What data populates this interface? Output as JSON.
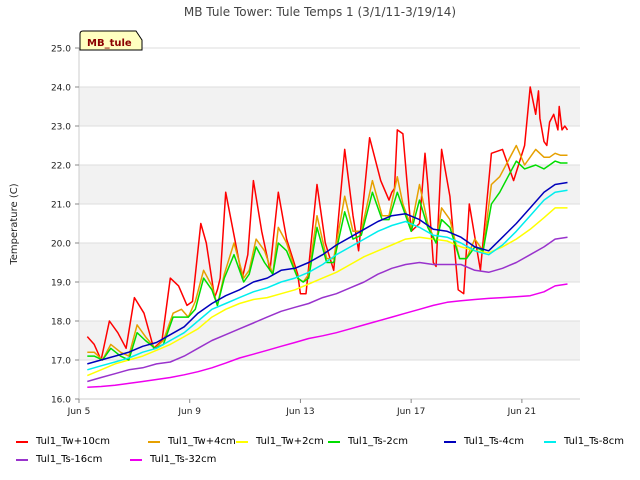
{
  "chart_data": {
    "type": "line",
    "title": "MB Tule Tower: Tule Temps 1 (3/1/11-3/19/14)",
    "site_label": "MB_tule",
    "xlabel": "",
    "ylabel": "Temperature (C)",
    "x_unit": "date (June)",
    "x_ticks": [
      {
        "value": 5,
        "label": "Jun 5"
      },
      {
        "value": 9,
        "label": "Jun 9"
      },
      {
        "value": 13,
        "label": "Jun 13"
      },
      {
        "value": 17,
        "label": "Jun 17"
      },
      {
        "value": 21,
        "label": "Jun 21"
      }
    ],
    "xlim": [
      5,
      23.1
    ],
    "ylim": [
      16.0,
      25.0
    ],
    "y_ticks": [
      "16.0",
      "17.0",
      "18.0",
      "19.0",
      "20.0",
      "21.0",
      "22.0",
      "23.0",
      "24.0",
      "25.0"
    ],
    "grid": true,
    "band_shading": true,
    "legend_position": "bottom",
    "series": [
      {
        "name": "Tul1_Tw+10cm",
        "color": "#ff0000",
        "x": [
          5.3,
          5.55,
          5.8,
          6.1,
          6.4,
          6.7,
          7.0,
          7.35,
          7.7,
          8.0,
          8.3,
          8.6,
          8.9,
          9.1,
          9.4,
          9.6,
          9.9,
          10.0,
          10.1,
          10.3,
          10.6,
          10.9,
          11.1,
          11.3,
          11.6,
          11.9,
          12.2,
          12.5,
          12.9,
          13.0,
          13.2,
          13.6,
          13.9,
          14.2,
          14.6,
          14.9,
          15.1,
          15.5,
          15.9,
          16.2,
          16.3,
          16.4,
          16.5,
          16.7,
          17.0,
          17.3,
          17.5,
          17.6,
          17.8,
          17.9,
          18.1,
          18.4,
          18.7,
          18.9,
          19.1,
          19.5,
          19.9,
          20.3,
          20.7,
          21.1,
          21.3,
          21.5,
          21.6,
          21.65,
          21.8,
          21.9,
          22.0,
          22.15,
          22.3,
          22.35,
          22.45,
          22.55,
          22.65
        ],
        "y": [
          17.6,
          17.4,
          17.0,
          18.0,
          17.7,
          17.3,
          18.6,
          18.2,
          17.3,
          17.5,
          19.1,
          18.9,
          18.4,
          18.5,
          20.5,
          20.0,
          18.6,
          18.8,
          19.1,
          21.3,
          20.2,
          19.1,
          19.7,
          21.6,
          20.3,
          19.3,
          21.3,
          20.1,
          19.2,
          18.7,
          18.7,
          21.5,
          20.0,
          19.3,
          22.4,
          20.7,
          19.8,
          22.7,
          21.6,
          21.1,
          21.3,
          21.4,
          22.9,
          22.8,
          20.3,
          20.5,
          22.3,
          21.5,
          19.5,
          19.4,
          22.4,
          21.2,
          18.8,
          18.7,
          21.0,
          19.3,
          22.3,
          22.4,
          21.6,
          22.5,
          24.0,
          23.3,
          23.9,
          23.2,
          22.6,
          22.5,
          23.1,
          23.3,
          22.9,
          23.5,
          22.9,
          23.0,
          22.9
        ]
      },
      {
        "name": "Tul1_Tw+4cm",
        "color": "#e6a000",
        "x": [
          5.3,
          5.55,
          5.85,
          6.15,
          6.5,
          6.8,
          7.1,
          7.4,
          7.75,
          8.05,
          8.4,
          8.7,
          8.95,
          9.2,
          9.5,
          9.8,
          10.0,
          10.25,
          10.6,
          10.95,
          11.15,
          11.4,
          11.7,
          12.0,
          12.2,
          12.5,
          12.9,
          13.1,
          13.3,
          13.6,
          13.95,
          14.2,
          14.6,
          14.9,
          15.2,
          15.6,
          15.95,
          16.2,
          16.5,
          16.7,
          17.0,
          17.3,
          17.6,
          17.9,
          18.1,
          18.4,
          18.75,
          19.0,
          19.3,
          19.6,
          19.9,
          20.2,
          20.5,
          20.8,
          21.1,
          21.5,
          21.8,
          22.0,
          22.2,
          22.4,
          22.65
        ],
        "y": [
          17.2,
          17.2,
          17.0,
          17.4,
          17.2,
          17.1,
          17.9,
          17.6,
          17.3,
          17.5,
          18.2,
          18.3,
          18.1,
          18.5,
          19.3,
          18.9,
          18.4,
          19.2,
          20.0,
          19.1,
          19.3,
          20.1,
          19.8,
          19.2,
          20.4,
          20.0,
          19.1,
          19.0,
          19.2,
          20.7,
          19.6,
          19.6,
          21.2,
          20.3,
          20.3,
          21.6,
          20.7,
          20.7,
          21.7,
          21.0,
          20.4,
          21.5,
          20.5,
          20.0,
          20.9,
          20.6,
          19.6,
          19.6,
          20.1,
          19.8,
          21.5,
          21.7,
          22.1,
          22.5,
          22.0,
          22.4,
          22.2,
          22.2,
          22.3,
          22.25,
          22.25
        ]
      },
      {
        "name": "Tul1_Tw+2cm",
        "color": "#ffff00",
        "x": [
          5.3,
          5.8,
          6.3,
          6.8,
          7.3,
          7.8,
          8.3,
          8.8,
          9.3,
          9.8,
          10.3,
          10.8,
          11.3,
          11.8,
          12.3,
          12.8,
          13.3,
          13.8,
          14.3,
          14.8,
          15.3,
          15.8,
          16.3,
          16.8,
          17.3,
          17.8,
          18.3,
          18.8,
          19.3,
          19.8,
          20.3,
          20.8,
          21.3,
          21.8,
          22.2,
          22.65
        ],
        "y": [
          16.6,
          16.75,
          16.9,
          17.0,
          17.1,
          17.25,
          17.4,
          17.6,
          17.8,
          18.1,
          18.3,
          18.45,
          18.55,
          18.6,
          18.7,
          18.8,
          18.95,
          19.1,
          19.25,
          19.45,
          19.65,
          19.8,
          19.95,
          20.1,
          20.15,
          20.1,
          20.05,
          19.9,
          19.8,
          19.75,
          19.9,
          20.1,
          20.35,
          20.65,
          20.9,
          20.9
        ]
      },
      {
        "name": "Tul1_Ts-2cm",
        "color": "#00dd00",
        "x": [
          5.3,
          5.55,
          5.85,
          6.15,
          6.5,
          6.8,
          7.1,
          7.4,
          7.75,
          8.05,
          8.4,
          8.7,
          8.95,
          9.2,
          9.5,
          9.8,
          10.0,
          10.25,
          10.6,
          10.95,
          11.15,
          11.4,
          11.7,
          12.0,
          12.2,
          12.5,
          12.9,
          13.1,
          13.3,
          13.6,
          13.95,
          14.2,
          14.6,
          14.9,
          15.2,
          15.6,
          15.95,
          16.2,
          16.5,
          16.7,
          17.0,
          17.3,
          17.6,
          17.9,
          18.1,
          18.4,
          18.75,
          19.0,
          19.3,
          19.6,
          19.9,
          20.2,
          20.5,
          20.8,
          21.1,
          21.5,
          21.8,
          22.0,
          22.2,
          22.4,
          22.65
        ],
        "y": [
          17.1,
          17.1,
          17.0,
          17.3,
          17.1,
          17.0,
          17.7,
          17.5,
          17.3,
          17.4,
          18.1,
          18.1,
          18.1,
          18.3,
          19.1,
          18.8,
          18.4,
          19.1,
          19.7,
          19.0,
          19.2,
          19.9,
          19.5,
          19.2,
          20.0,
          19.8,
          19.1,
          19.0,
          19.1,
          20.4,
          19.5,
          19.5,
          20.8,
          20.1,
          20.2,
          21.3,
          20.6,
          20.6,
          21.3,
          20.9,
          20.3,
          21.1,
          20.4,
          20.0,
          20.6,
          20.4,
          19.6,
          19.6,
          19.9,
          19.8,
          21.0,
          21.3,
          21.7,
          22.1,
          21.9,
          22.0,
          21.9,
          22.0,
          22.1,
          22.05,
          22.05
        ]
      },
      {
        "name": "Tul1_Ts-4cm",
        "color": "#0000bb",
        "x": [
          5.3,
          5.8,
          6.3,
          6.8,
          7.3,
          7.8,
          8.3,
          8.8,
          9.3,
          9.8,
          10.3,
          10.8,
          11.3,
          11.8,
          12.3,
          12.8,
          13.3,
          13.8,
          14.3,
          14.8,
          15.3,
          15.8,
          16.3,
          16.8,
          17.3,
          17.8,
          18.3,
          18.8,
          19.3,
          19.8,
          20.3,
          20.8,
          21.3,
          21.8,
          22.2,
          22.65
        ],
        "y": [
          16.9,
          17.0,
          17.1,
          17.2,
          17.35,
          17.45,
          17.65,
          17.85,
          18.2,
          18.45,
          18.65,
          18.8,
          19.0,
          19.1,
          19.3,
          19.35,
          19.5,
          19.7,
          19.95,
          20.15,
          20.35,
          20.55,
          20.7,
          20.75,
          20.6,
          20.35,
          20.3,
          20.15,
          19.9,
          19.8,
          20.15,
          20.5,
          20.9,
          21.3,
          21.5,
          21.55
        ]
      },
      {
        "name": "Tul1_Ts-8cm",
        "color": "#00eeee",
        "x": [
          5.3,
          5.8,
          6.3,
          6.8,
          7.3,
          7.8,
          8.3,
          8.8,
          9.3,
          9.8,
          10.3,
          10.8,
          11.3,
          11.8,
          12.3,
          12.8,
          13.3,
          13.8,
          14.3,
          14.8,
          15.3,
          15.8,
          16.3,
          16.8,
          17.3,
          17.8,
          18.3,
          18.8,
          19.3,
          19.8,
          20.3,
          20.8,
          21.3,
          21.8,
          22.2,
          22.65
        ],
        "y": [
          16.75,
          16.85,
          16.95,
          17.05,
          17.2,
          17.3,
          17.5,
          17.7,
          18.0,
          18.3,
          18.45,
          18.6,
          18.75,
          18.85,
          19.0,
          19.1,
          19.25,
          19.45,
          19.7,
          19.9,
          20.1,
          20.3,
          20.45,
          20.55,
          20.4,
          20.2,
          20.15,
          20.0,
          19.8,
          19.7,
          19.95,
          20.3,
          20.7,
          21.1,
          21.3,
          21.35
        ]
      },
      {
        "name": "Tul1_Ts-16cm",
        "color": "#9933cc",
        "x": [
          5.3,
          5.8,
          6.3,
          6.8,
          7.3,
          7.8,
          8.3,
          8.8,
          9.3,
          9.8,
          10.3,
          10.8,
          11.3,
          11.8,
          12.3,
          12.8,
          13.3,
          13.8,
          14.3,
          14.8,
          15.3,
          15.8,
          16.3,
          16.8,
          17.3,
          17.8,
          18.3,
          18.8,
          19.3,
          19.8,
          20.3,
          20.8,
          21.3,
          21.8,
          22.2,
          22.65
        ],
        "y": [
          16.45,
          16.55,
          16.65,
          16.75,
          16.8,
          16.9,
          16.95,
          17.1,
          17.3,
          17.5,
          17.65,
          17.8,
          17.95,
          18.1,
          18.25,
          18.35,
          18.45,
          18.6,
          18.7,
          18.85,
          19.0,
          19.2,
          19.35,
          19.45,
          19.5,
          19.45,
          19.45,
          19.45,
          19.3,
          19.25,
          19.35,
          19.5,
          19.7,
          19.9,
          20.1,
          20.15
        ]
      },
      {
        "name": "Tul1_Ts-32cm",
        "color": "#ee00ee",
        "x": [
          5.3,
          5.8,
          6.3,
          6.8,
          7.3,
          7.8,
          8.3,
          8.8,
          9.3,
          9.8,
          10.3,
          10.8,
          11.3,
          11.8,
          12.3,
          12.8,
          13.3,
          13.8,
          14.3,
          14.8,
          15.3,
          15.8,
          16.3,
          16.8,
          17.3,
          17.8,
          18.3,
          18.8,
          19.3,
          19.8,
          20.3,
          20.8,
          21.3,
          21.8,
          22.2,
          22.65
        ],
        "y": [
          16.3,
          16.32,
          16.35,
          16.4,
          16.45,
          16.5,
          16.55,
          16.62,
          16.7,
          16.8,
          16.92,
          17.05,
          17.15,
          17.25,
          17.35,
          17.45,
          17.55,
          17.62,
          17.7,
          17.8,
          17.9,
          18.0,
          18.1,
          18.2,
          18.3,
          18.4,
          18.48,
          18.52,
          18.55,
          18.58,
          18.6,
          18.62,
          18.65,
          18.75,
          18.9,
          18.95
        ]
      }
    ]
  },
  "legend_items": [
    {
      "name": "Tul1_Tw+10cm",
      "color": "#ff0000"
    },
    {
      "name": "Tul1_Tw+4cm",
      "color": "#e6a000"
    },
    {
      "name": "Tul1_Tw+2cm",
      "color": "#ffff00"
    },
    {
      "name": "Tul1_Ts-2cm",
      "color": "#00dd00"
    },
    {
      "name": "Tul1_Ts-4cm",
      "color": "#0000bb"
    },
    {
      "name": "Tul1_Ts-8cm",
      "color": "#00eeee"
    },
    {
      "name": "Tul1_Ts-16cm",
      "color": "#9933cc"
    },
    {
      "name": "Tul1_Ts-32cm",
      "color": "#ee00ee"
    }
  ]
}
